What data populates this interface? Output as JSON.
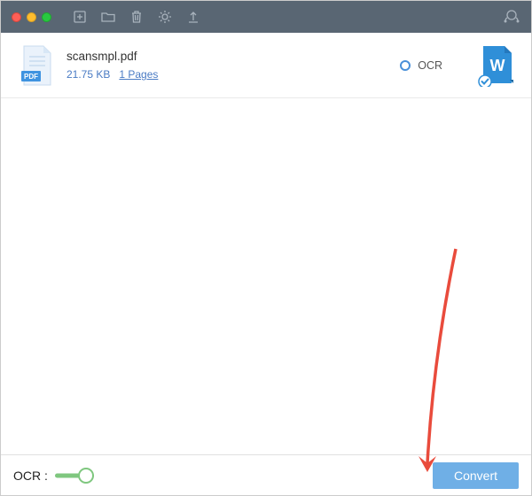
{
  "file": {
    "name": "scansmpl.pdf",
    "size": "21.75 KB",
    "pages": "1 Pages",
    "ocr_label": "OCR"
  },
  "footer": {
    "ocr_label": "OCR :",
    "convert_label": "Convert"
  }
}
